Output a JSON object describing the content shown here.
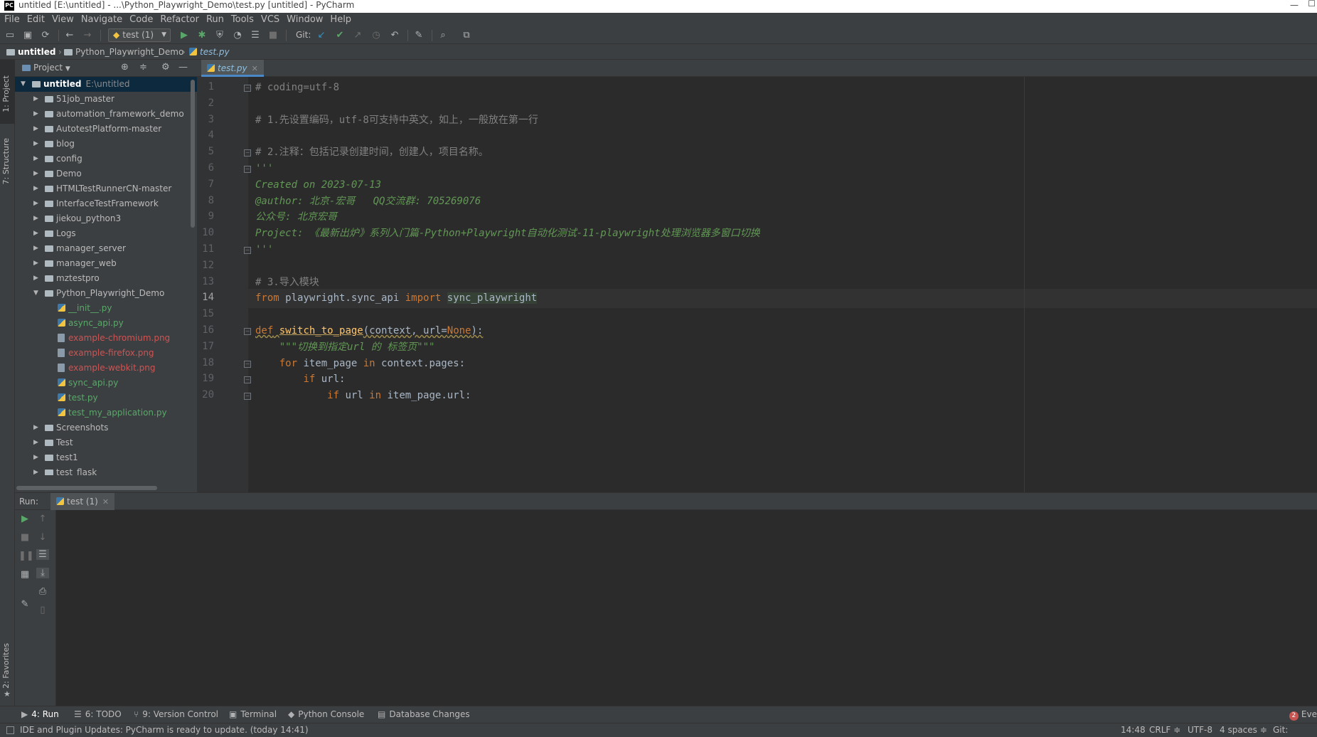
{
  "window": {
    "title": "untitled [E:\\untitled] - ...\\Python_Playwright_Demo\\test.py [untitled] - PyCharm",
    "app_icon": "PC"
  },
  "menu": [
    "File",
    "Edit",
    "View",
    "Navigate",
    "Code",
    "Refactor",
    "Run",
    "Tools",
    "VCS",
    "Window",
    "Help"
  ],
  "toolbar": {
    "run_config": "test (1)",
    "git_label": "Git:"
  },
  "breadcrumb": [
    "untitled",
    "Python_Playwright_Demo",
    "test.py"
  ],
  "left_stripe": {
    "project_tab": "1: Project",
    "structure_tab": "7: Structure",
    "favorites_tab": "2: Favorites"
  },
  "project": {
    "title": "Project",
    "tree": [
      {
        "label": "untitled",
        "hint": "E:\\untitled",
        "level": 0,
        "expanded": true,
        "type": "folder",
        "style": "bold"
      },
      {
        "label": "51job_master",
        "level": 1,
        "type": "folder"
      },
      {
        "label": "automation_framework_demo",
        "level": 1,
        "type": "folder"
      },
      {
        "label": "AutotestPlatform-master",
        "level": 1,
        "type": "folder"
      },
      {
        "label": "blog",
        "level": 1,
        "type": "folder"
      },
      {
        "label": "config",
        "level": 1,
        "type": "folder"
      },
      {
        "label": "Demo",
        "level": 1,
        "type": "folder"
      },
      {
        "label": "HTMLTestRunnerCN-master",
        "level": 1,
        "type": "folder"
      },
      {
        "label": "InterfaceTestFramework",
        "level": 1,
        "type": "folder"
      },
      {
        "label": "jiekou_python3",
        "level": 1,
        "type": "folder"
      },
      {
        "label": "Logs",
        "level": 1,
        "type": "folder"
      },
      {
        "label": "manager_server",
        "level": 1,
        "type": "folder"
      },
      {
        "label": "manager_web",
        "level": 1,
        "type": "folder"
      },
      {
        "label": "mztestpro",
        "level": 1,
        "type": "folder"
      },
      {
        "label": "Python_Playwright_Demo",
        "level": 1,
        "expanded": true,
        "type": "folder"
      },
      {
        "label": "__init__.py",
        "level": 2,
        "type": "py",
        "style": "green"
      },
      {
        "label": "async_api.py",
        "level": 2,
        "type": "py",
        "style": "green"
      },
      {
        "label": "example-chromium.png",
        "level": 2,
        "type": "img",
        "style": "red"
      },
      {
        "label": "example-firefox.png",
        "level": 2,
        "type": "img",
        "style": "red"
      },
      {
        "label": "example-webkit.png",
        "level": 2,
        "type": "img",
        "style": "red"
      },
      {
        "label": "sync_api.py",
        "level": 2,
        "type": "py",
        "style": "green"
      },
      {
        "label": "test.py",
        "level": 2,
        "type": "py",
        "style": "green"
      },
      {
        "label": "test_my_application.py",
        "level": 2,
        "type": "py",
        "style": "green"
      },
      {
        "label": "Screenshots",
        "level": 1,
        "type": "folder"
      },
      {
        "label": "Test",
        "level": 1,
        "type": "folder"
      },
      {
        "label": "test1",
        "level": 1,
        "type": "folder"
      },
      {
        "label": "test_flask",
        "level": 1,
        "type": "folder"
      }
    ]
  },
  "editor": {
    "tab": "test.py",
    "current_line": 14,
    "lines": [
      [
        {
          "t": "# coding=utf-8",
          "c": "com"
        }
      ],
      [],
      [
        {
          "t": "# 1.先设置编码，utf-8可支持中英文，如上，一般放在第一行",
          "c": "com"
        }
      ],
      [],
      [
        {
          "t": "# 2.注释：包括记录创建时间，创建人，项目名称。",
          "c": "com"
        }
      ],
      [
        {
          "t": "'''",
          "c": "doc"
        }
      ],
      [
        {
          "t": "Created on 2023-07-13",
          "c": "doc"
        }
      ],
      [
        {
          "t": "@author: 北京-宏哥   QQ交流群: 705269076",
          "c": "doc"
        }
      ],
      [
        {
          "t": "公众号: 北京宏哥",
          "c": "doc"
        }
      ],
      [
        {
          "t": "Project: 《最新出炉》系列入门篇-Python+Playwright自动化测试-11-playwright处理浏览器多窗口切换",
          "c": "doc"
        }
      ],
      [
        {
          "t": "'''",
          "c": "doc"
        }
      ],
      [],
      [
        {
          "t": "# 3.导入模块",
          "c": "com"
        }
      ],
      [
        {
          "t": "from",
          "c": "kw"
        },
        {
          "t": " playwright.sync_api ",
          "c": ""
        },
        {
          "t": "import",
          "c": "kw"
        },
        {
          "t": " ",
          "c": ""
        },
        {
          "t": "sync_playwright",
          "c": "hl"
        }
      ],
      [],
      [
        {
          "t": "def",
          "c": "kw sq"
        },
        {
          "t": " ",
          "c": "sq"
        },
        {
          "t": "switch_to_page",
          "c": "fn"
        },
        {
          "t": "(context, url=",
          "c": "sq"
        },
        {
          "t": "None",
          "c": "kw sq"
        },
        {
          "t": "):",
          "c": "sq"
        }
      ],
      [
        {
          "t": "    \"\"\"切换到指定url 的 标签页\"\"\"",
          "c": "doc"
        }
      ],
      [
        {
          "t": "    ",
          "c": ""
        },
        {
          "t": "for",
          "c": "kw"
        },
        {
          "t": " item_page ",
          "c": ""
        },
        {
          "t": "in",
          "c": "kw"
        },
        {
          "t": " context.pages:",
          "c": ""
        }
      ],
      [
        {
          "t": "        ",
          "c": ""
        },
        {
          "t": "if",
          "c": "kw"
        },
        {
          "t": " url:",
          "c": ""
        }
      ],
      [
        {
          "t": "            ",
          "c": ""
        },
        {
          "t": "if",
          "c": "kw"
        },
        {
          "t": " url ",
          "c": ""
        },
        {
          "t": "in",
          "c": "kw"
        },
        {
          "t": " item_page.url:",
          "c": ""
        }
      ]
    ],
    "fold_lines": [
      1,
      5,
      6,
      11,
      16,
      18,
      19,
      20
    ]
  },
  "run": {
    "label": "Run:",
    "tab": "test (1)"
  },
  "bottom_tabs": [
    {
      "label": "4: Run",
      "icon": "▶",
      "active": true
    },
    {
      "label": "6: TODO",
      "icon": "☰"
    },
    {
      "label": "9: Version Control",
      "icon": "⑂"
    },
    {
      "label": "Terminal",
      "icon": "▣"
    },
    {
      "label": "Python Console",
      "icon": "◆"
    },
    {
      "label": "Database Changes",
      "icon": "▤"
    }
  ],
  "event_log": {
    "count": "2",
    "label": "Eve"
  },
  "status": {
    "message": "IDE and Plugin Updates: PyCharm is ready to update. (today 14:41)",
    "position": "14:48",
    "line_sep": "CRLF ≑",
    "encoding": "UTF-8",
    "indent": "4 spaces ≑",
    "vcs": "Git: master"
  }
}
